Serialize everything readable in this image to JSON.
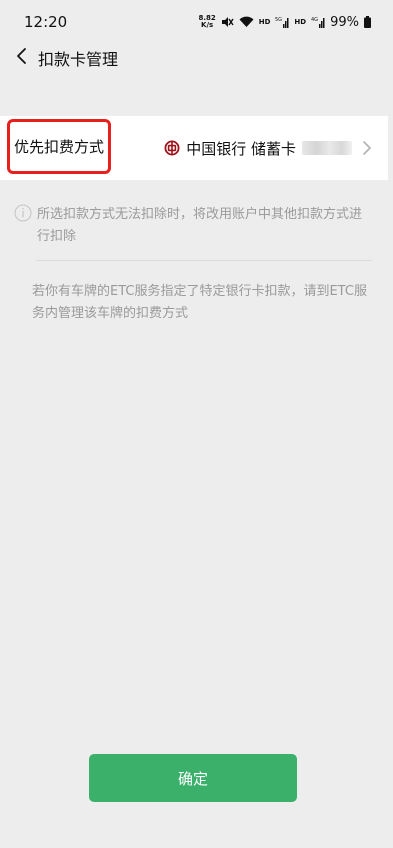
{
  "status_bar": {
    "time": "12:20",
    "net_speed_value": "8.82",
    "net_speed_unit": "K/s",
    "hd1": "HD",
    "hd2": "HD",
    "signal1_tag": "5G",
    "signal2_tag": "4G",
    "battery": "99%",
    "icons": [
      "mute-icon",
      "wifi-icon",
      "signal-icon",
      "battery-icon"
    ]
  },
  "nav": {
    "title": "扣款卡管理",
    "back_icon": "chevron-left-icon"
  },
  "payment": {
    "label": "优先扣费方式",
    "bank_icon": "bank-of-china-logo",
    "bank_name": "中国银行 储蓄卡",
    "chevron_icon": "chevron-right-icon"
  },
  "notes": {
    "fallback": "所选扣款方式无法扣除时，将改用账户中其他扣款方式进行扣除",
    "etc": "若你有车牌的ETC服务指定了特定银行卡扣款，请到ETC服务内管理该车牌的扣费方式"
  },
  "confirm": {
    "label": "确定"
  },
  "colors": {
    "background": "#ededed",
    "card": "#ffffff",
    "highlight_border": "#e8201c",
    "primary_button": "#3ab06b",
    "muted_text": "#9a9a9a",
    "bank_logo": "#a0121a"
  }
}
